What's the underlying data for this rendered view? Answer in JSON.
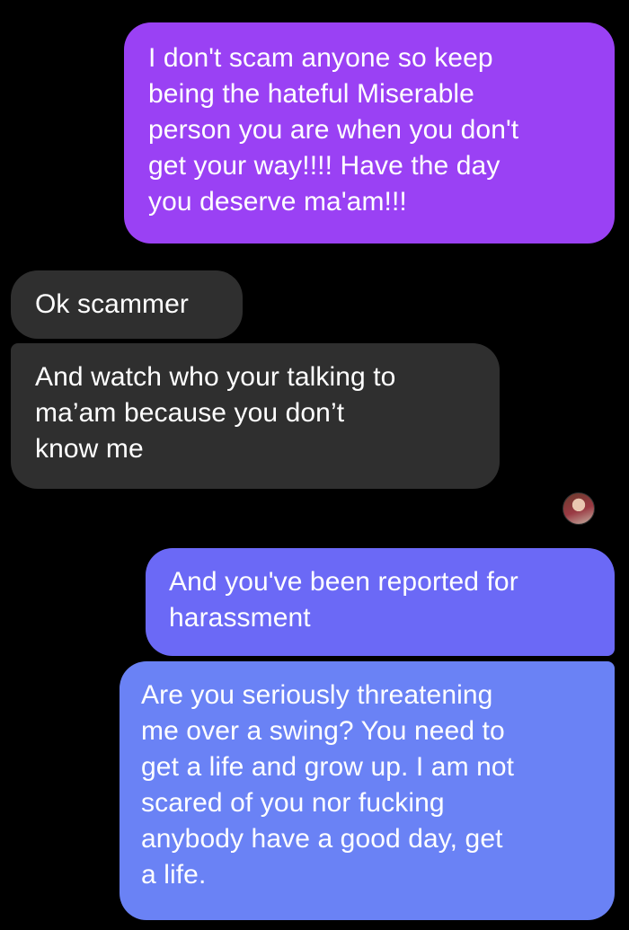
{
  "conversation": {
    "messages": [
      {
        "sender": "me",
        "text": "I don't scam anyone so keep\nbeing the hateful Miserable\nperson you are when you don't\nget your way!!!! Have the day\nyou deserve ma'am!!!"
      },
      {
        "sender": "them",
        "text": "Ok scammer"
      },
      {
        "sender": "them",
        "text": "And watch who your talking to\nma’am because you don’t\nknow me"
      },
      {
        "sender": "me",
        "text": "And you've been reported for\nharassment"
      },
      {
        "sender": "me",
        "text": "Are you seriously threatening\nme over a swing? You need to\nget a life and grow up. I am not\nscared of you nor fucking\nanybody have a good day, get\na life."
      }
    ]
  },
  "colors": {
    "background": "#000000",
    "received_bubble": "#2f2f2f",
    "sent_bubble_purple": "#9a41f4",
    "sent_bubble_indigo": "#6b69f6",
    "sent_bubble_blue": "#6a82f5"
  },
  "icons": {
    "read_receipt": "avatar-read-receipt-icon"
  }
}
